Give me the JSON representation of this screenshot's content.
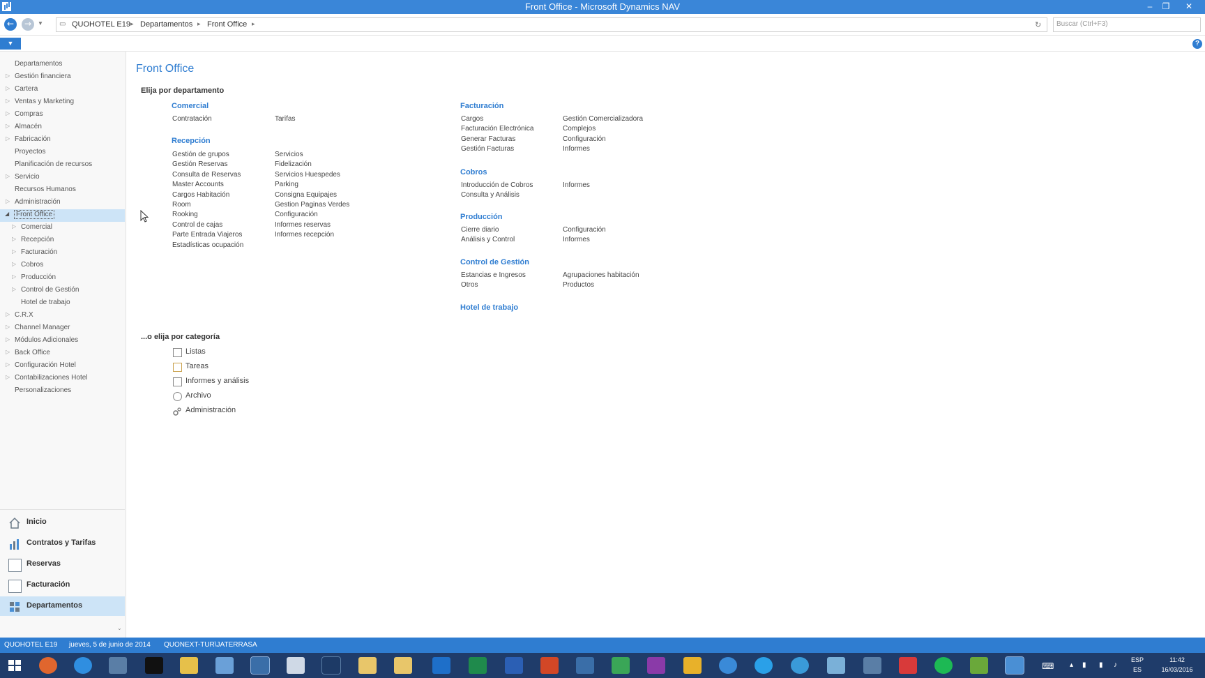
{
  "window": {
    "title": "Front Office - Microsoft Dynamics NAV",
    "minimize": "‒",
    "restore": "❐",
    "close": "✕"
  },
  "address": {
    "crumbs": [
      "QUOHOTEL E19",
      "Departamentos",
      "Front Office"
    ],
    "search_placeholder": "Buscar (Ctrl+F3)"
  },
  "nav_tree": [
    {
      "label": "Departamentos",
      "arrow": ""
    },
    {
      "label": "Gestión financiera",
      "arrow": "▷"
    },
    {
      "label": "Cartera",
      "arrow": "▷"
    },
    {
      "label": "Ventas y Marketing",
      "arrow": "▷"
    },
    {
      "label": "Compras",
      "arrow": "▷"
    },
    {
      "label": "Almacén",
      "arrow": "▷"
    },
    {
      "label": "Fabricación",
      "arrow": "▷"
    },
    {
      "label": "Proyectos",
      "arrow": ""
    },
    {
      "label": "Planificación de recursos",
      "arrow": ""
    },
    {
      "label": "Servicio",
      "arrow": "▷"
    },
    {
      "label": "Recursos Humanos",
      "arrow": ""
    },
    {
      "label": "Administración",
      "arrow": "▷"
    },
    {
      "label": "Front Office",
      "arrow": "◢"
    },
    {
      "label": "Comercial",
      "arrow": "▷"
    },
    {
      "label": "Recepción",
      "arrow": "▷"
    },
    {
      "label": "Facturación",
      "arrow": "▷"
    },
    {
      "label": "Cobros",
      "arrow": "▷"
    },
    {
      "label": "Producción",
      "arrow": "▷"
    },
    {
      "label": "Control de Gestión",
      "arrow": "▷"
    },
    {
      "label": "Hotel de trabajo",
      "arrow": ""
    },
    {
      "label": "C.R.X",
      "arrow": "▷"
    },
    {
      "label": "Channel Manager",
      "arrow": "▷"
    },
    {
      "label": "Módulos Adicionales",
      "arrow": "▷"
    },
    {
      "label": "Back Office",
      "arrow": "▷"
    },
    {
      "label": "Configuración Hotel",
      "arrow": "▷"
    },
    {
      "label": "Contabilizaciones Hotel",
      "arrow": "▷"
    },
    {
      "label": "Personalizaciones",
      "arrow": ""
    }
  ],
  "nav_buttons": [
    "Inicio",
    "Contratos y Tarifas",
    "Reservas",
    "Facturación",
    "Departamentos"
  ],
  "main": {
    "title": "Front Office",
    "by_department": "Elija por departamento",
    "by_category": "...o elija por categoría",
    "groups": {
      "comercial": {
        "title": "Comercial",
        "col1": [
          "Contratación"
        ],
        "col2": [
          "Tarifas"
        ]
      },
      "recepcion": {
        "title": "Recepción",
        "col1": [
          "Gestión de grupos",
          "Gestión Reservas",
          "Consulta de Reservas",
          "Master Accounts",
          "Cargos Habitación",
          "Room",
          "Rooking",
          "Control de cajas",
          "Parte Entrada Viajeros",
          "Estadísticas ocupación"
        ],
        "col2": [
          "Servicios",
          "Fidelización",
          "Servicios Huespedes",
          "Parking",
          "Consigna Equipajes",
          "Gestion Paginas Verdes",
          "Configuración",
          "Informes reservas",
          "Informes recepción"
        ]
      },
      "facturacion": {
        "title": "Facturación",
        "col1": [
          "Cargos",
          "Facturación Electrónica",
          "Generar Facturas",
          "Gestión Facturas"
        ],
        "col2": [
          "Gestión Comercializadora",
          "Complejos",
          "Configuración",
          "Informes"
        ]
      },
      "cobros": {
        "title": "Cobros",
        "col1": [
          "Introducción de Cobros",
          "Consulta y Análisis"
        ],
        "col2": [
          "Informes"
        ]
      },
      "produccion": {
        "title": "Producción",
        "col1": [
          "Cierre diario",
          "Análisis y Control"
        ],
        "col2": [
          "Configuración",
          "Informes"
        ]
      },
      "control": {
        "title": "Control de Gestión",
        "col1": [
          "Estancias e Ingresos",
          "Otros"
        ],
        "col2": [
          "Agrupaciones habitación",
          "Productos"
        ]
      },
      "hotel": {
        "title": "Hotel de trabajo"
      }
    },
    "categories": [
      "Listas",
      "Tareas",
      "Informes y análisis",
      "Archivo",
      "Administración"
    ]
  },
  "status": {
    "company": "QUOHOTEL E19",
    "date": "jueves, 5 de junio de 2014",
    "user": "QUONEXT-TUR\\JATERRASA"
  },
  "tray": {
    "lang1": "ESP",
    "lang2": "ES",
    "time": "11:42",
    "date": "16/03/2016"
  },
  "colors": {
    "accent": "#2f7dd1",
    "titlebar": "#3a86d8",
    "taskbar": "#1f3c6a"
  }
}
